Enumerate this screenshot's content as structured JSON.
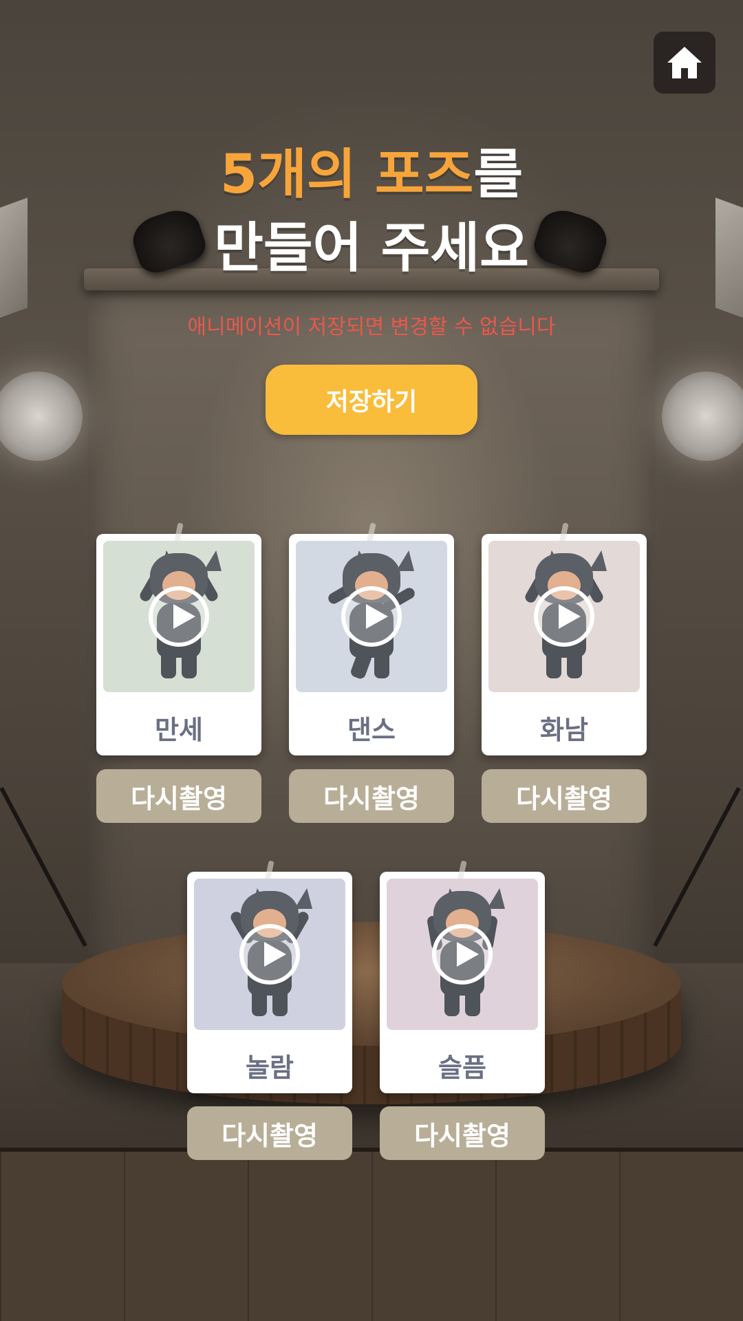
{
  "header": {
    "title_line1_highlight": "5개의 포즈",
    "title_line1_rest": "를",
    "title_line2": "만들어 주세요",
    "subtitle": "애니메이션이 저장되면 변경할 수 없습니다",
    "save_label": "저장하기"
  },
  "colors": {
    "highlight": "#f7a53b",
    "warning": "#e9584d",
    "save_button": "#f9bd3b",
    "retake_button": "#b8ad97",
    "thumb_backgrounds": [
      "#d6dfd3",
      "#d2d9e3",
      "#e3d9d6",
      "#d0d1e0",
      "#e0d2db"
    ]
  },
  "icons": {
    "home": "home-icon",
    "play": "play-icon"
  },
  "poses": [
    {
      "label": "만세",
      "retake_label": "다시촬영"
    },
    {
      "label": "댄스",
      "retake_label": "다시촬영"
    },
    {
      "label": "화남",
      "retake_label": "다시촬영"
    },
    {
      "label": "놀람",
      "retake_label": "다시촬영"
    },
    {
      "label": "슬픔",
      "retake_label": "다시촬영"
    }
  ]
}
